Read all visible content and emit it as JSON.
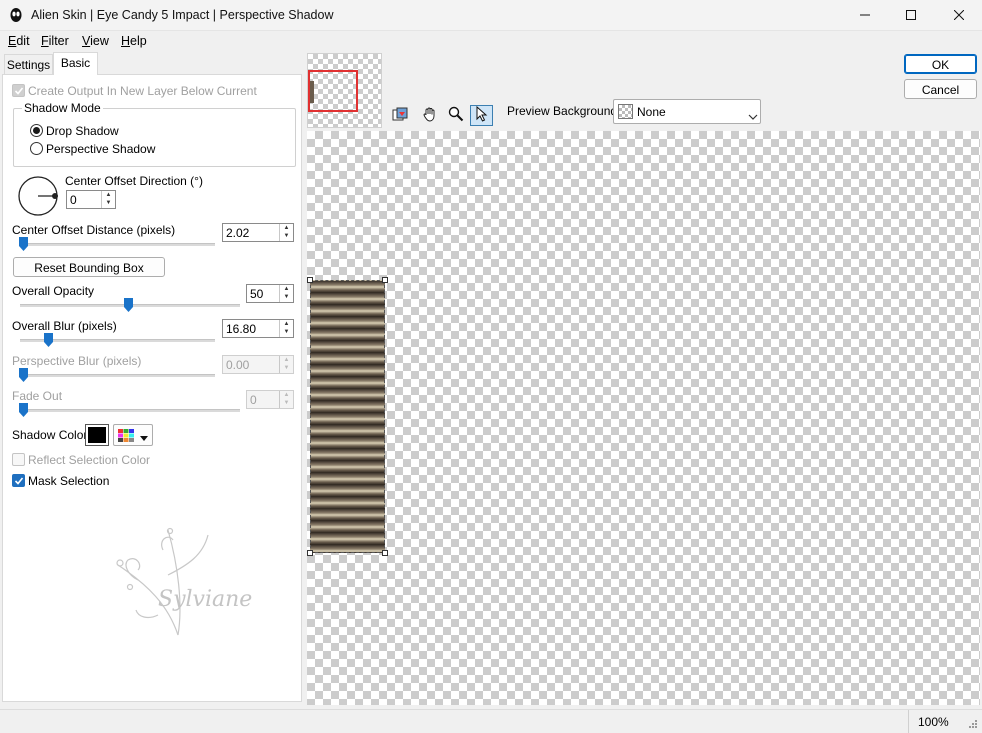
{
  "window": {
    "title": "Alien Skin | Eye Candy 5 Impact | Perspective Shadow",
    "minimize_icon": "minimize-icon",
    "maximize_icon": "maximize-icon",
    "close_icon": "close-icon"
  },
  "menu": [
    "Edit",
    "Filter",
    "View",
    "Help"
  ],
  "tabs": {
    "settings": "Settings",
    "basic": "Basic"
  },
  "basic": {
    "create_output_label": "Create Output In New Layer Below Current",
    "create_output_checked": true,
    "shadow_mode_label": "Shadow Mode",
    "drop_shadow_label": "Drop Shadow",
    "perspective_shadow_label": "Perspective Shadow",
    "selected_mode": "Drop Shadow",
    "center_offset_direction_label": "Center Offset Direction (°)",
    "center_offset_direction_value": "0",
    "center_offset_distance_label": "Center Offset Distance (pixels)",
    "center_offset_distance_value": "2.02",
    "reset_bounding_box_label": "Reset Bounding Box",
    "overall_opacity_label": "Overall Opacity",
    "overall_opacity_value": "50",
    "overall_blur_label": "Overall Blur (pixels)",
    "overall_blur_value": "16.80",
    "perspective_blur_label": "Perspective Blur (pixels)",
    "perspective_blur_value": "0.00",
    "fade_out_label": "Fade Out",
    "fade_out_value": "0",
    "shadow_color_label": "Shadow Color",
    "shadow_color": "#000000",
    "reflect_selection_color_label": "Reflect Selection Color",
    "reflect_selection_color_checked": false,
    "mask_selection_label": "Mask Selection",
    "mask_selection_checked": true
  },
  "watermark_text": "Sylviane",
  "buttons": {
    "ok": "OK",
    "cancel": "Cancel"
  },
  "preview": {
    "background_label": "Preview Background:",
    "background_value": "None"
  },
  "status": {
    "zoom": "100%"
  },
  "colors": {
    "accent": "#0067c0",
    "checked": "#1f6fbf",
    "thumb": "#1a73c9"
  }
}
